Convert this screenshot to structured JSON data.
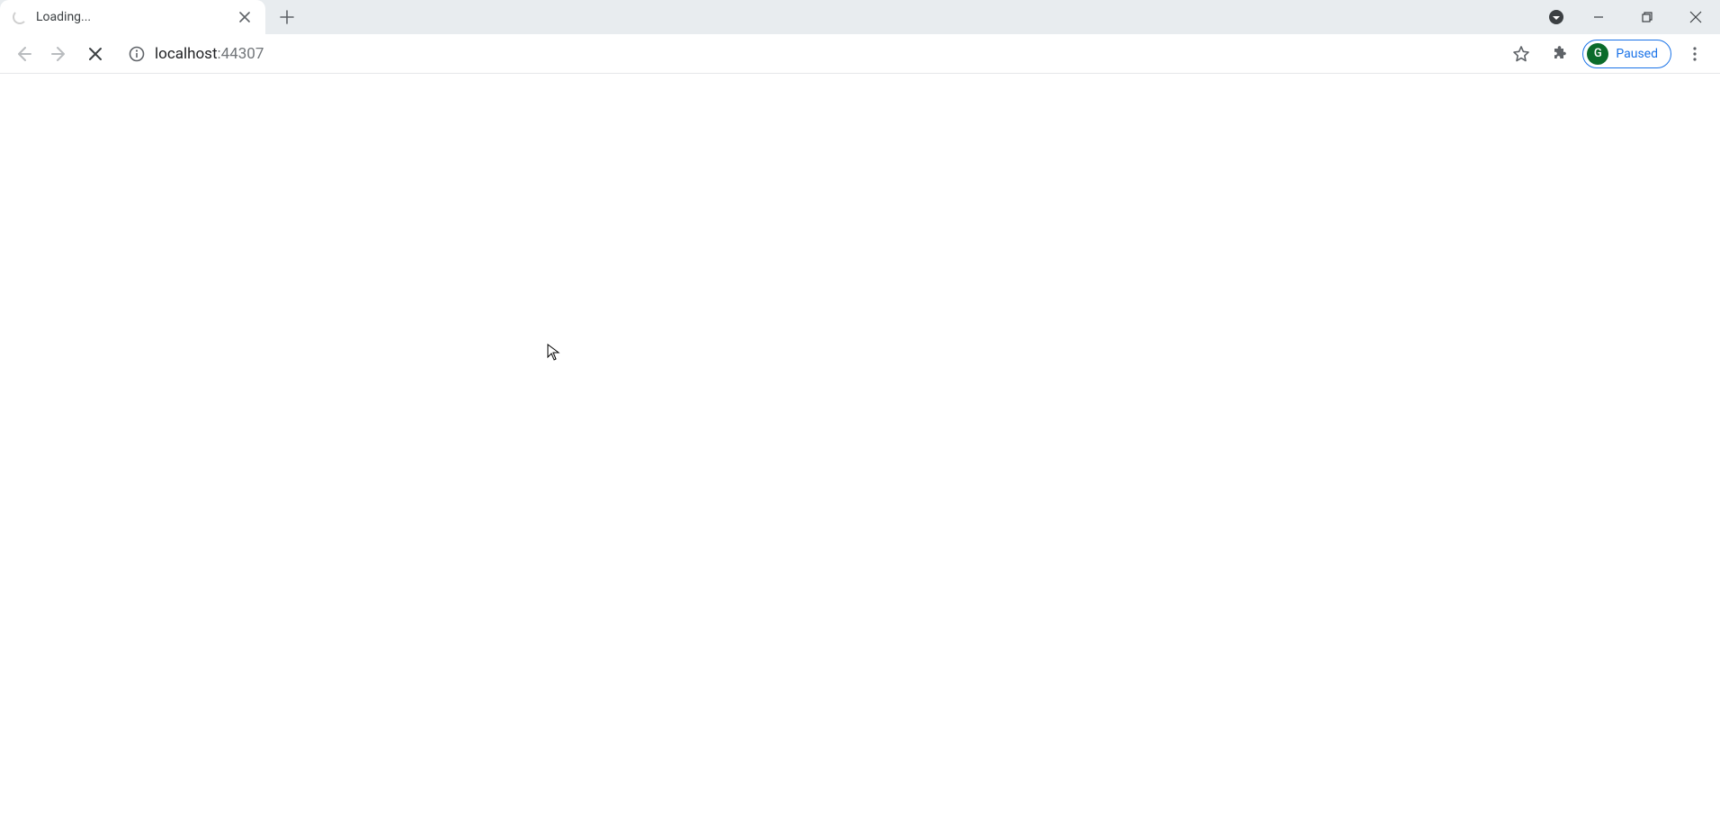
{
  "tab": {
    "title": "Loading..."
  },
  "address": {
    "host": "localhost",
    "port": ":44307"
  },
  "profile": {
    "initial": "G",
    "status": "Paused"
  }
}
